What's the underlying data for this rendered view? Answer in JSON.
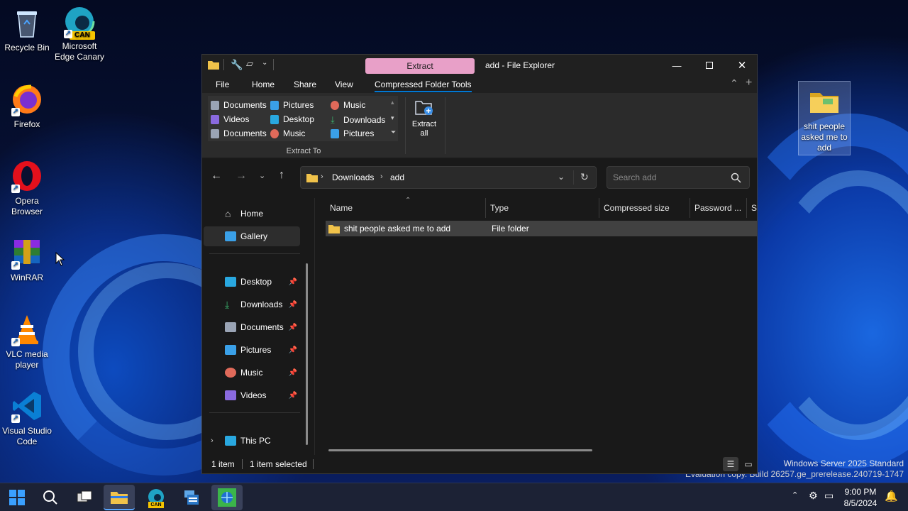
{
  "desktop": {
    "icons": [
      {
        "label": "Recycle Bin"
      },
      {
        "label": "Microsoft Edge Canary",
        "badge": "CAN"
      },
      {
        "label": "Firefox"
      },
      {
        "label": "Opera Browser"
      },
      {
        "label": "WinRAR"
      },
      {
        "label": "VLC media player"
      },
      {
        "label": "Visual Studio Code"
      },
      {
        "label": "shit people asked me to add"
      }
    ],
    "watermark": {
      "line1": "Windows Server 2025 Standard",
      "line2": "Evaluation copy. Build 26257.ge_prerelease.240719-1747"
    }
  },
  "window": {
    "title": "add - File Explorer",
    "extract_tab": "Extract",
    "menu": [
      "File",
      "Home",
      "Share",
      "View",
      "Compressed Folder Tools"
    ],
    "ribbon": {
      "col1": [
        "Documents",
        "Videos",
        "Documents"
      ],
      "col2": [
        "Pictures",
        "Desktop",
        "Music"
      ],
      "col3": [
        "Music",
        "Downloads",
        "Pictures"
      ],
      "group_label": "Extract To",
      "extract_all": "Extract all"
    },
    "breadcrumb": [
      "Downloads",
      "add"
    ],
    "search_placeholder": "Search add",
    "sidebar": {
      "top": [
        "Home",
        "Gallery"
      ],
      "pinned": [
        "Desktop",
        "Downloads",
        "Documents",
        "Pictures",
        "Music",
        "Videos"
      ],
      "this_pc": "This PC"
    },
    "columns": [
      "Name",
      "Type",
      "Compressed size",
      "Password ...",
      "Si"
    ],
    "files": [
      {
        "name": "shit people asked me to add",
        "type": "File folder"
      }
    ],
    "status": {
      "count": "1 item",
      "selected": "1 item selected"
    }
  },
  "taskbar": {
    "time": "9:00 PM",
    "date": "8/5/2024",
    "edge_badge": "CAN"
  },
  "colors": {
    "accent": "#0078d4",
    "extract_tab": "#e8a0c8",
    "folder": "#f0c24a"
  }
}
